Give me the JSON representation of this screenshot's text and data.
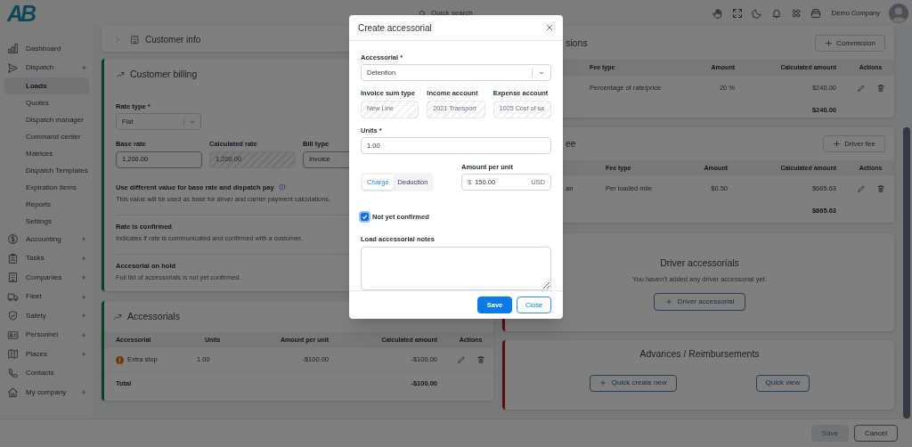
{
  "header": {
    "logo": "AB",
    "search_placeholder": "Quick search",
    "company": "Demo Company"
  },
  "sidebar": {
    "items": [
      {
        "label": "Dashboard",
        "kind": "link",
        "selected": false
      },
      {
        "label": "Dispatch",
        "kind": "group",
        "expanded": true,
        "selected": false,
        "children": [
          {
            "label": "Loads",
            "selected": true
          },
          {
            "label": "Quotes",
            "selected": false
          },
          {
            "label": "Dispatch manager",
            "selected": false
          },
          {
            "label": "Command center",
            "selected": false
          },
          {
            "label": "Matrices",
            "selected": false
          },
          {
            "label": "Dispatch Templates",
            "selected": false
          },
          {
            "label": "Expiration items",
            "selected": false
          },
          {
            "label": "Reports",
            "selected": false
          },
          {
            "label": "Settings",
            "selected": false
          }
        ]
      },
      {
        "label": "Accounting",
        "kind": "group",
        "expanded": false,
        "selected": false
      },
      {
        "label": "Tasks",
        "kind": "group",
        "expanded": false,
        "selected": false
      },
      {
        "label": "Companies",
        "kind": "group",
        "expanded": false,
        "selected": false
      },
      {
        "label": "Fleet",
        "kind": "group",
        "expanded": false,
        "selected": false
      },
      {
        "label": "Safety",
        "kind": "group",
        "expanded": false,
        "selected": false
      },
      {
        "label": "Personnel",
        "kind": "group",
        "expanded": false,
        "selected": false
      },
      {
        "label": "Places",
        "kind": "group",
        "expanded": false,
        "selected": false
      },
      {
        "label": "Contacts",
        "kind": "link",
        "selected": false
      },
      {
        "label": "My company",
        "kind": "group",
        "expanded": false,
        "selected": false
      }
    ]
  },
  "customer_info": {
    "title": "Customer info",
    "expanded": false
  },
  "customer_billing": {
    "title": "Customer billing",
    "rate_type": {
      "label": "Rate type *",
      "value": "Flat"
    },
    "fields": [
      {
        "label": "Base rate",
        "value": "1,200.00",
        "disabled": false
      },
      {
        "label": "Calculated rate",
        "value": "1,200.00",
        "disabled": true
      },
      {
        "label": "Bill type",
        "value": "Invoice",
        "disabled": false
      }
    ],
    "options": [
      {
        "title": "Use different value for base rate and dispatch pay",
        "description": "This value will be used as base for driver and carrier payment calculations.",
        "info": true
      },
      {
        "title": "Rate is confirmed",
        "description": "Indicates if rate is communicated and confirmed with a customer.",
        "info": false
      },
      {
        "title": "Accesorial on hold",
        "description": "Full list of accessorials is not yet confirmed.",
        "info": false
      }
    ]
  },
  "accessorials": {
    "title": "Accessorials",
    "columns": [
      "Accessorial",
      "Units",
      "Amount per unit",
      "Calculated amount",
      "Actions"
    ],
    "rows": [
      {
        "cells": [
          "Extra stop",
          "1.00",
          "-$100.00",
          "-$100.00"
        ],
        "warning": true
      }
    ],
    "total": {
      "label": "Total",
      "amount": "-$100.00"
    }
  },
  "commissions": {
    "title": "sions",
    "button": "Commission",
    "columns": [
      "Fee type",
      "Amount",
      "Calculated amount",
      "Actions"
    ],
    "rows": [
      {
        "cells": [
          "Percentage of rate/price",
          "20 %",
          "$240.00"
        ]
      }
    ],
    "total": "$240.00"
  },
  "driver_fee": {
    "title": "ee",
    "button": "Driver fee",
    "columns": [
      "Fee type",
      "Amount",
      "Calculated amount",
      "Actions"
    ],
    "rows": [
      {
        "lead": "an",
        "cells": [
          "Per loaded mile",
          "$0.50",
          "$665.63"
        ]
      }
    ],
    "total": "$665.63"
  },
  "driver_accessorials": {
    "title": "Driver accessorials",
    "message": "You haven’t added any driver accessorial yet.",
    "button": "Driver accessorial"
  },
  "advances": {
    "title": "Advances / Reimbursements",
    "buttons": [
      {
        "label": "Quick create new",
        "plus": true
      },
      {
        "label": "Quick view",
        "plus": false
      }
    ]
  },
  "footer": {
    "buttons": [
      {
        "label": "Save",
        "disabled": true
      },
      {
        "label": "Cancel",
        "disabled": false
      }
    ]
  },
  "modal": {
    "title": "Create accessorial",
    "accessorial": {
      "label": "Accessorial *",
      "value": "Detention"
    },
    "accounts": [
      {
        "label": "Invoice sum type",
        "value": "New Line"
      },
      {
        "label": "Income account",
        "value": "2021 Transport"
      },
      {
        "label": "Expense account",
        "value": "1025 Cost of sa"
      }
    ],
    "units": {
      "label": "Units *",
      "value": "1.00"
    },
    "type_options": [
      {
        "label": "Charge",
        "selected": true
      },
      {
        "label": "Deduction",
        "selected": false
      }
    ],
    "amount": {
      "label": "Amount per unit",
      "prefix": "$",
      "value": "150.00",
      "currency": "USD"
    },
    "not_confirmed": {
      "label": "Not yet confirmed",
      "checked": true
    },
    "notes": {
      "label": "Load accessorial notes"
    },
    "buttons": [
      {
        "label": "Save",
        "kind": "primary"
      },
      {
        "label": "Close",
        "kind": "secondary"
      }
    ]
  }
}
